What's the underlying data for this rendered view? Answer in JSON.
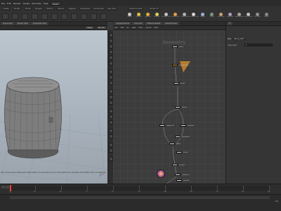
{
  "menubar": {
    "items": [
      "File",
      "Edit",
      "Render",
      "Assets",
      "Windows",
      "Help"
    ],
    "desktop": "Build"
  },
  "shelf": {
    "tabs": [
      "Create",
      "Modify",
      "Model",
      "Polygon",
      "Deform",
      "Texture",
      "Rigging",
      "Characters",
      "Constraints",
      "Hair Utils",
      "Guide Process",
      "Terrain FX"
    ],
    "tools": [
      {
        "label": "Cameras",
        "color": "#c9c9c9"
      },
      {
        "label": "Point Light",
        "color": "#e0c040"
      },
      {
        "label": "Spot Light",
        "color": "#e0b030"
      },
      {
        "label": "Area Light",
        "color": "#d8d060"
      },
      {
        "label": "Geometry Light",
        "color": "#c0c0c0"
      },
      {
        "label": "Volume Light",
        "color": "#e0a040"
      },
      {
        "label": "Distant Light",
        "color": "#b0b0b0"
      },
      {
        "label": "Environment Light",
        "color": "#d4d4d4"
      },
      {
        "label": "Sky Light",
        "color": "#9ab0d0"
      },
      {
        "label": "GI Light",
        "color": "#7a9a7a"
      },
      {
        "label": "Caustic Light",
        "color": "#c0a070"
      },
      {
        "label": "Portal Light",
        "color": "#b09ac0"
      },
      {
        "label": "Ambient Light",
        "color": "#a0a0a0"
      },
      {
        "label": "Stereo Camera",
        "color": "#c0c0c0"
      },
      {
        "label": "VR Camera",
        "color": "#909090"
      },
      {
        "label": "Switcher",
        "color": "#888888"
      }
    ]
  },
  "viewport": {
    "tabs": [
      "Scene View",
      "Render View",
      "Composite View"
    ],
    "perspective": "Persp",
    "cam": "No cam",
    "hint": "Left mouse tumbles. Middle pans. Right dollies. Ctrl+Alt+Left box-zooms. Ctrl+Right zooms. Spacebar-Ctrl-Left tilts. Hold L for alternate tumble, dolly, and zoom. M or Alt+M for First Person Navigation."
  },
  "network": {
    "tabs": [
      "/obj/geo1/barrel",
      "Tree View",
      "Material Palette",
      "Asset Browser"
    ],
    "bar": [
      "Add",
      "Edit",
      "Go",
      "View",
      "Tools",
      "Layout",
      "Help"
    ],
    "context_label": "Geometry",
    "nodes": [
      "tube1",
      "polyextrude1",
      "bend1",
      "lattice1",
      "polybevel1",
      "boolean1",
      "color1",
      "merge1",
      "transform1",
      "xform2",
      "uvflatten1",
      "normal1",
      "OUT"
    ]
  },
  "params": {
    "node_type": "Null",
    "node_name": "barrel_OUT",
    "field_label": "Copy Input",
    "field_value": "1"
  },
  "timeline": {
    "start": "1",
    "end": "240",
    "marks": [
      "24",
      "48",
      "72",
      "96",
      "120",
      "144",
      "168",
      "192",
      "216",
      "240"
    ]
  }
}
